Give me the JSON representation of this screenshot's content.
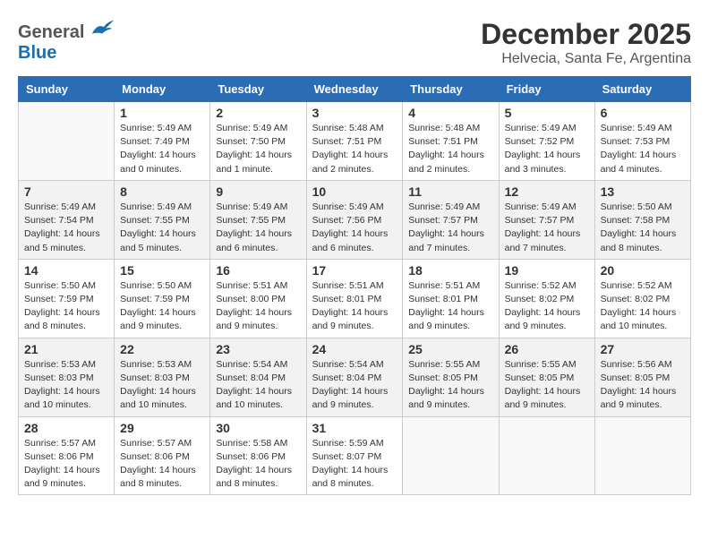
{
  "header": {
    "logo_general": "General",
    "logo_blue": "Blue",
    "month": "December 2025",
    "location": "Helvecia, Santa Fe, Argentina"
  },
  "weekdays": [
    "Sunday",
    "Monday",
    "Tuesday",
    "Wednesday",
    "Thursday",
    "Friday",
    "Saturday"
  ],
  "weeks": [
    [
      {
        "day": "",
        "sunrise": "",
        "sunset": "",
        "daylight": ""
      },
      {
        "day": "1",
        "sunrise": "Sunrise: 5:49 AM",
        "sunset": "Sunset: 7:49 PM",
        "daylight": "Daylight: 14 hours and 0 minutes."
      },
      {
        "day": "2",
        "sunrise": "Sunrise: 5:49 AM",
        "sunset": "Sunset: 7:50 PM",
        "daylight": "Daylight: 14 hours and 1 minute."
      },
      {
        "day": "3",
        "sunrise": "Sunrise: 5:48 AM",
        "sunset": "Sunset: 7:51 PM",
        "daylight": "Daylight: 14 hours and 2 minutes."
      },
      {
        "day": "4",
        "sunrise": "Sunrise: 5:48 AM",
        "sunset": "Sunset: 7:51 PM",
        "daylight": "Daylight: 14 hours and 2 minutes."
      },
      {
        "day": "5",
        "sunrise": "Sunrise: 5:49 AM",
        "sunset": "Sunset: 7:52 PM",
        "daylight": "Daylight: 14 hours and 3 minutes."
      },
      {
        "day": "6",
        "sunrise": "Sunrise: 5:49 AM",
        "sunset": "Sunset: 7:53 PM",
        "daylight": "Daylight: 14 hours and 4 minutes."
      }
    ],
    [
      {
        "day": "7",
        "sunrise": "Sunrise: 5:49 AM",
        "sunset": "Sunset: 7:54 PM",
        "daylight": "Daylight: 14 hours and 5 minutes."
      },
      {
        "day": "8",
        "sunrise": "Sunrise: 5:49 AM",
        "sunset": "Sunset: 7:55 PM",
        "daylight": "Daylight: 14 hours and 5 minutes."
      },
      {
        "day": "9",
        "sunrise": "Sunrise: 5:49 AM",
        "sunset": "Sunset: 7:55 PM",
        "daylight": "Daylight: 14 hours and 6 minutes."
      },
      {
        "day": "10",
        "sunrise": "Sunrise: 5:49 AM",
        "sunset": "Sunset: 7:56 PM",
        "daylight": "Daylight: 14 hours and 6 minutes."
      },
      {
        "day": "11",
        "sunrise": "Sunrise: 5:49 AM",
        "sunset": "Sunset: 7:57 PM",
        "daylight": "Daylight: 14 hours and 7 minutes."
      },
      {
        "day": "12",
        "sunrise": "Sunrise: 5:49 AM",
        "sunset": "Sunset: 7:57 PM",
        "daylight": "Daylight: 14 hours and 7 minutes."
      },
      {
        "day": "13",
        "sunrise": "Sunrise: 5:50 AM",
        "sunset": "Sunset: 7:58 PM",
        "daylight": "Daylight: 14 hours and 8 minutes."
      }
    ],
    [
      {
        "day": "14",
        "sunrise": "Sunrise: 5:50 AM",
        "sunset": "Sunset: 7:59 PM",
        "daylight": "Daylight: 14 hours and 8 minutes."
      },
      {
        "day": "15",
        "sunrise": "Sunrise: 5:50 AM",
        "sunset": "Sunset: 7:59 PM",
        "daylight": "Daylight: 14 hours and 9 minutes."
      },
      {
        "day": "16",
        "sunrise": "Sunrise: 5:51 AM",
        "sunset": "Sunset: 8:00 PM",
        "daylight": "Daylight: 14 hours and 9 minutes."
      },
      {
        "day": "17",
        "sunrise": "Sunrise: 5:51 AM",
        "sunset": "Sunset: 8:01 PM",
        "daylight": "Daylight: 14 hours and 9 minutes."
      },
      {
        "day": "18",
        "sunrise": "Sunrise: 5:51 AM",
        "sunset": "Sunset: 8:01 PM",
        "daylight": "Daylight: 14 hours and 9 minutes."
      },
      {
        "day": "19",
        "sunrise": "Sunrise: 5:52 AM",
        "sunset": "Sunset: 8:02 PM",
        "daylight": "Daylight: 14 hours and 9 minutes."
      },
      {
        "day": "20",
        "sunrise": "Sunrise: 5:52 AM",
        "sunset": "Sunset: 8:02 PM",
        "daylight": "Daylight: 14 hours and 10 minutes."
      }
    ],
    [
      {
        "day": "21",
        "sunrise": "Sunrise: 5:53 AM",
        "sunset": "Sunset: 8:03 PM",
        "daylight": "Daylight: 14 hours and 10 minutes."
      },
      {
        "day": "22",
        "sunrise": "Sunrise: 5:53 AM",
        "sunset": "Sunset: 8:03 PM",
        "daylight": "Daylight: 14 hours and 10 minutes."
      },
      {
        "day": "23",
        "sunrise": "Sunrise: 5:54 AM",
        "sunset": "Sunset: 8:04 PM",
        "daylight": "Daylight: 14 hours and 10 minutes."
      },
      {
        "day": "24",
        "sunrise": "Sunrise: 5:54 AM",
        "sunset": "Sunset: 8:04 PM",
        "daylight": "Daylight: 14 hours and 9 minutes."
      },
      {
        "day": "25",
        "sunrise": "Sunrise: 5:55 AM",
        "sunset": "Sunset: 8:05 PM",
        "daylight": "Daylight: 14 hours and 9 minutes."
      },
      {
        "day": "26",
        "sunrise": "Sunrise: 5:55 AM",
        "sunset": "Sunset: 8:05 PM",
        "daylight": "Daylight: 14 hours and 9 minutes."
      },
      {
        "day": "27",
        "sunrise": "Sunrise: 5:56 AM",
        "sunset": "Sunset: 8:05 PM",
        "daylight": "Daylight: 14 hours and 9 minutes."
      }
    ],
    [
      {
        "day": "28",
        "sunrise": "Sunrise: 5:57 AM",
        "sunset": "Sunset: 8:06 PM",
        "daylight": "Daylight: 14 hours and 9 minutes."
      },
      {
        "day": "29",
        "sunrise": "Sunrise: 5:57 AM",
        "sunset": "Sunset: 8:06 PM",
        "daylight": "Daylight: 14 hours and 8 minutes."
      },
      {
        "day": "30",
        "sunrise": "Sunrise: 5:58 AM",
        "sunset": "Sunset: 8:06 PM",
        "daylight": "Daylight: 14 hours and 8 minutes."
      },
      {
        "day": "31",
        "sunrise": "Sunrise: 5:59 AM",
        "sunset": "Sunset: 8:07 PM",
        "daylight": "Daylight: 14 hours and 8 minutes."
      },
      {
        "day": "",
        "sunrise": "",
        "sunset": "",
        "daylight": ""
      },
      {
        "day": "",
        "sunrise": "",
        "sunset": "",
        "daylight": ""
      },
      {
        "day": "",
        "sunrise": "",
        "sunset": "",
        "daylight": ""
      }
    ]
  ]
}
